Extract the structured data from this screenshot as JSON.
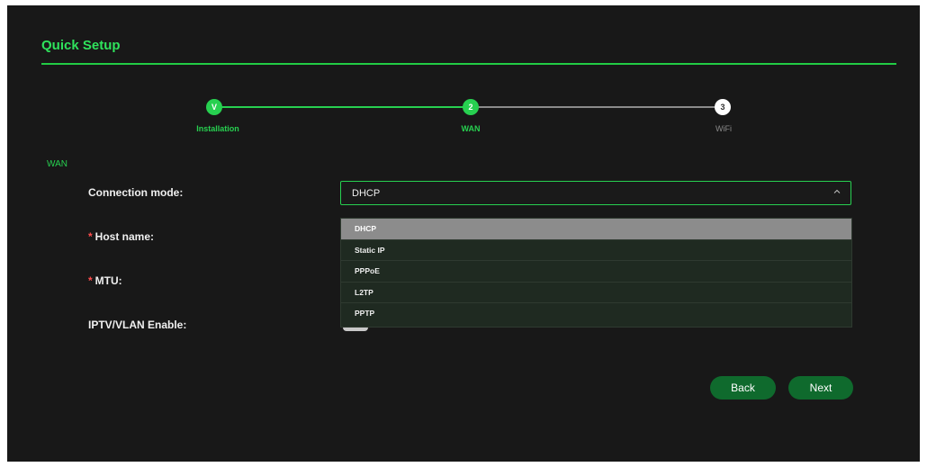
{
  "header": {
    "title": "Quick Setup"
  },
  "steps": [
    {
      "marker": "V",
      "label": "Installation",
      "state": "done"
    },
    {
      "marker": "2",
      "label": "WAN",
      "state": "active"
    },
    {
      "marker": "3",
      "label": "WiFi",
      "state": "pending"
    }
  ],
  "section_title": "WAN",
  "fields": {
    "connection_mode": {
      "label": "Connection mode:",
      "value": "DHCP"
    },
    "host_name": {
      "label": "Host name:",
      "required_mark": "*"
    },
    "mtu": {
      "label": "MTU:",
      "required_mark": "*"
    },
    "iptv_vlan": {
      "label": "IPTV/VLAN Enable:"
    }
  },
  "dropdown": {
    "options": [
      "DHCP",
      "Static IP",
      "PPPoE",
      "L2TP",
      "PPTP"
    ],
    "selected": "DHCP"
  },
  "buttons": {
    "back": "Back",
    "next": "Next"
  },
  "colors": {
    "accent": "#27d050",
    "background": "#181818",
    "button": "#0f6a2d"
  }
}
